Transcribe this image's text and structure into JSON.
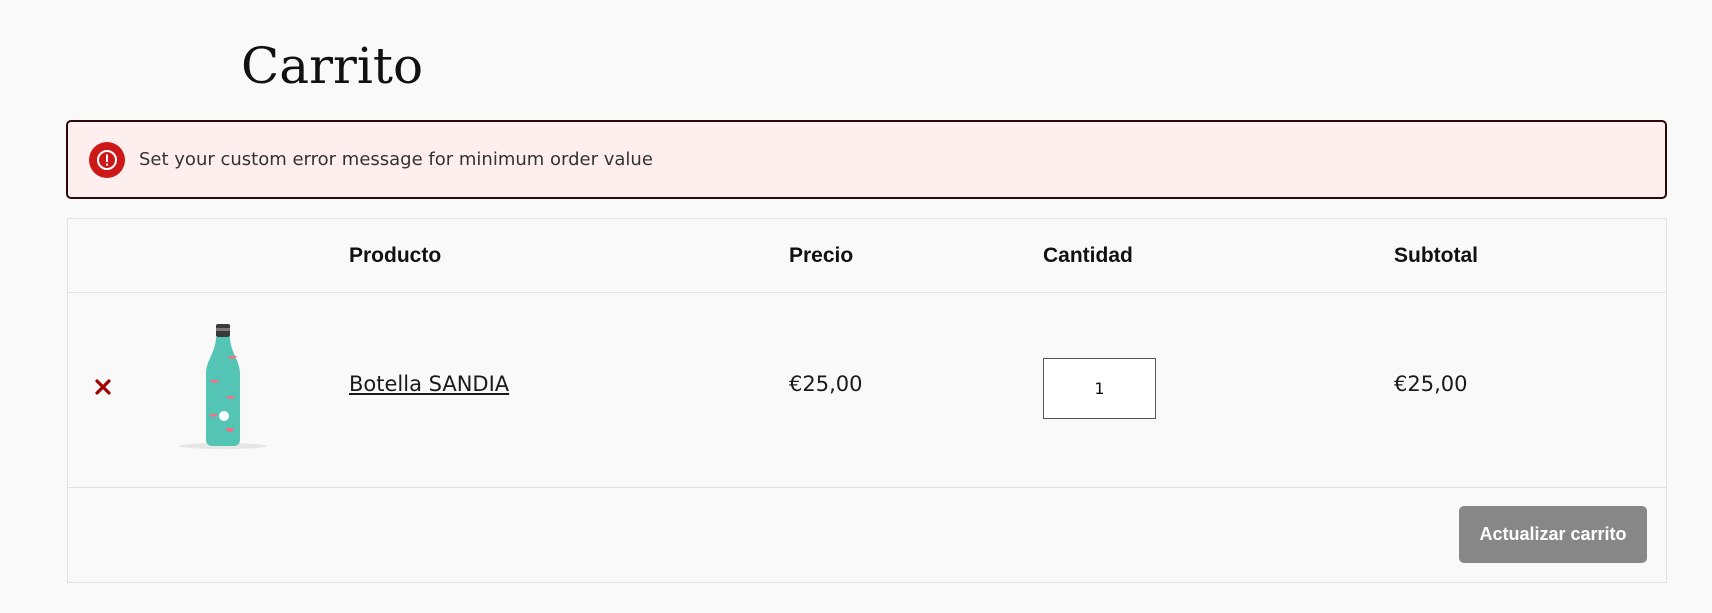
{
  "page": {
    "title": "Carrito"
  },
  "notice": {
    "type": "error",
    "icon": "exclamation-circle-icon",
    "color": "#cc1818",
    "message": "Set your custom error message for minimum order value"
  },
  "cart": {
    "headers": {
      "product": "Producto",
      "price": "Precio",
      "quantity": "Cantidad",
      "subtotal": "Subtotal"
    },
    "items": [
      {
        "name": "Botella SANDIA",
        "price": "€25,00",
        "quantity": "1",
        "subtotal": "€25,00",
        "remove_icon": "close-icon",
        "remove_color": "#a00000",
        "thumbnail": "bottle-watermelon-image"
      }
    ],
    "update_button_label": "Actualizar carrito",
    "update_button_color": "#878787"
  }
}
